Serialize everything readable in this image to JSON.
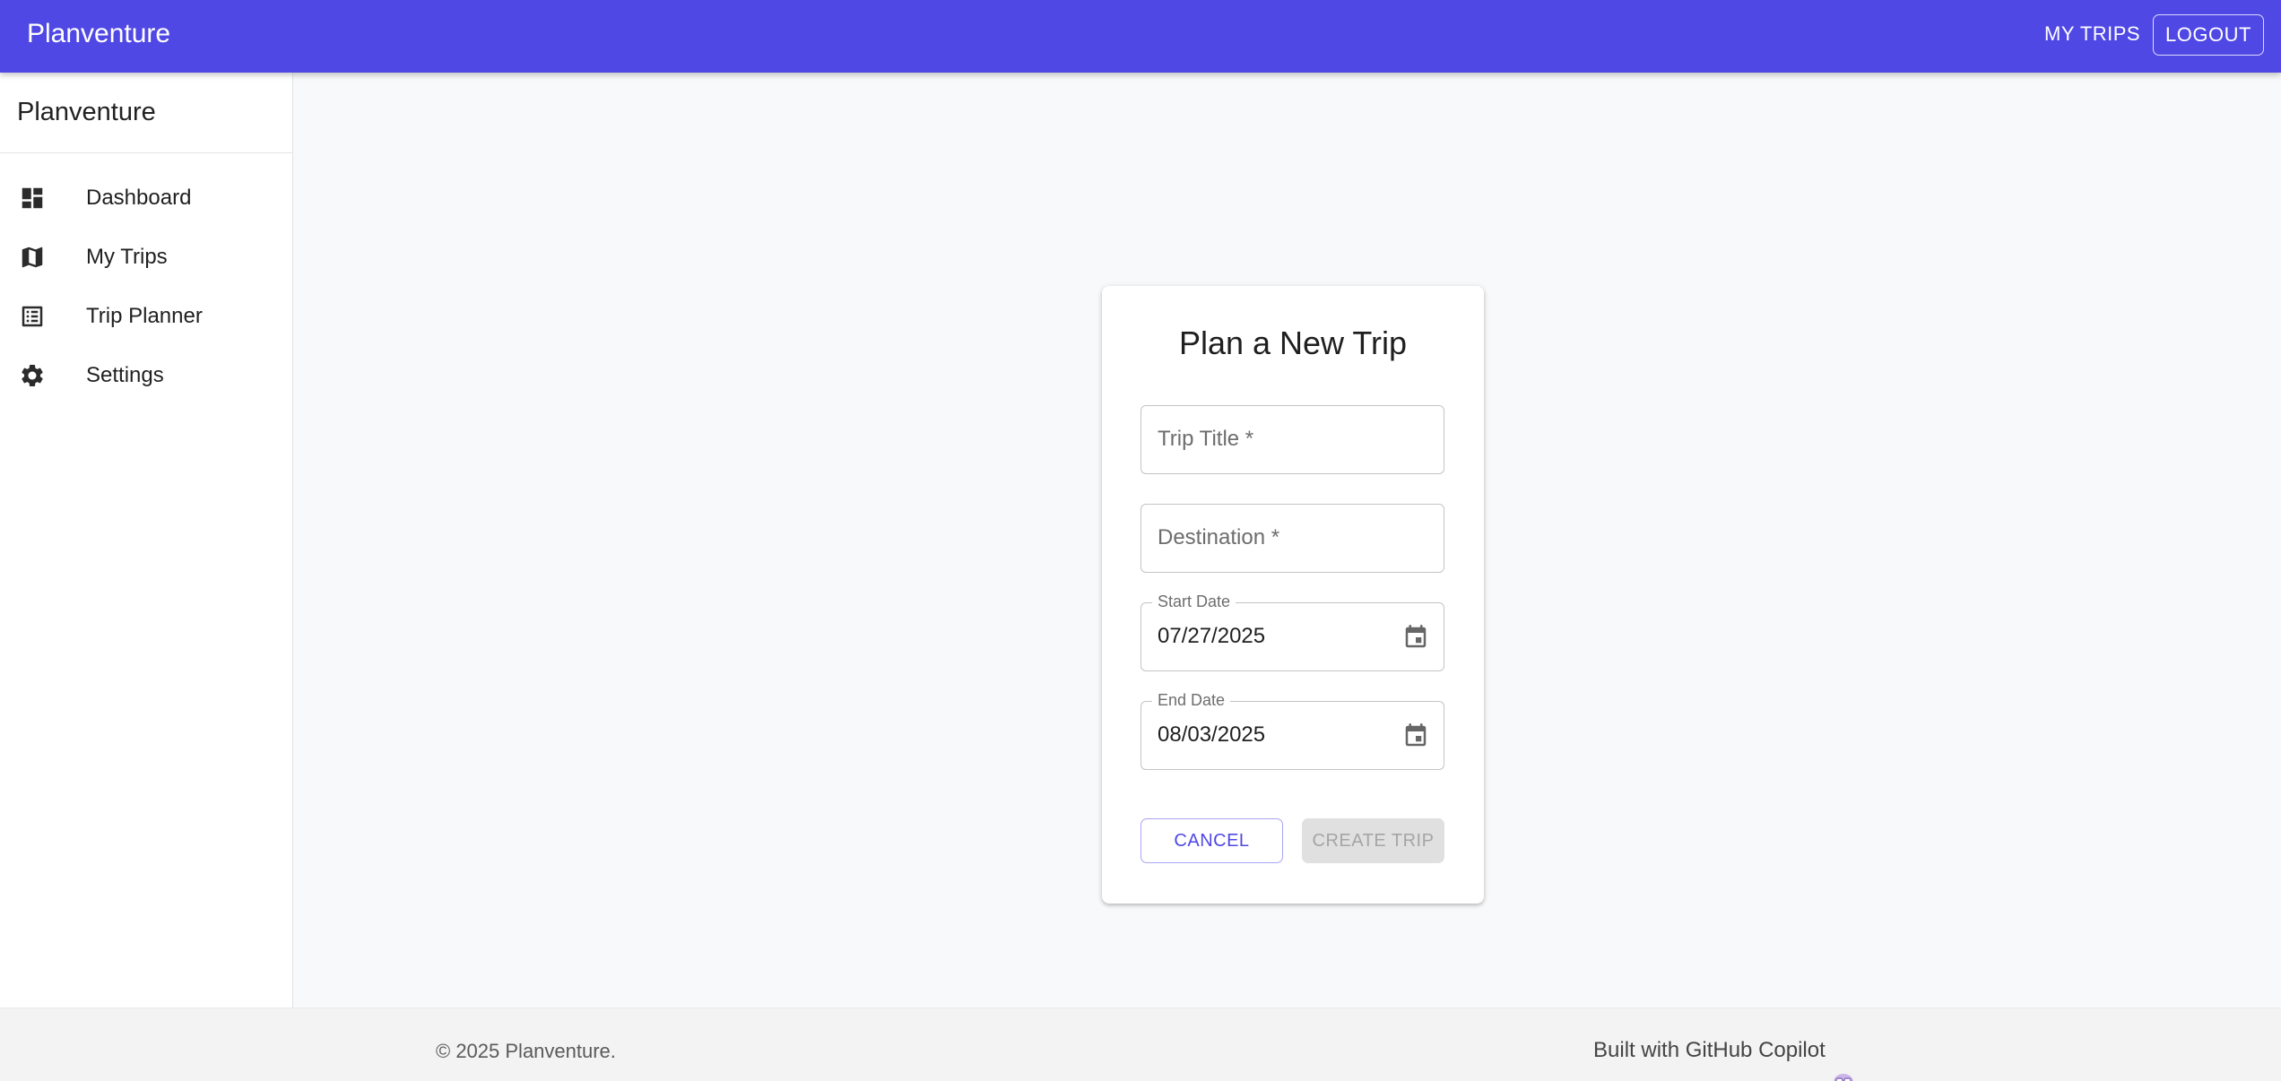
{
  "appbar": {
    "brand": "Planventure",
    "nav_my_trips": "MY TRIPS",
    "logout": "LOGOUT",
    "color": "#5048e5"
  },
  "sidebar": {
    "title": "Planventure",
    "items": [
      {
        "label": "Dashboard",
        "icon": "dashboard-icon"
      },
      {
        "label": "My Trips",
        "icon": "map-icon"
      },
      {
        "label": "Trip Planner",
        "icon": "list-icon"
      },
      {
        "label": "Settings",
        "icon": "gear-icon"
      }
    ]
  },
  "form": {
    "title": "Plan a New Trip",
    "trip_title_placeholder": "Trip Title *",
    "destination_placeholder": "Destination *",
    "start_date_label": "Start Date",
    "start_date_value": "07/27/2025",
    "end_date_label": "End Date",
    "end_date_value": "08/03/2025",
    "cancel": "CANCEL",
    "create": "CREATE TRIP"
  },
  "footer": {
    "copyright": "© 2025 Planventure.",
    "built_with": "Built with GitHub Copilot",
    "icon": "copilot-icon"
  }
}
